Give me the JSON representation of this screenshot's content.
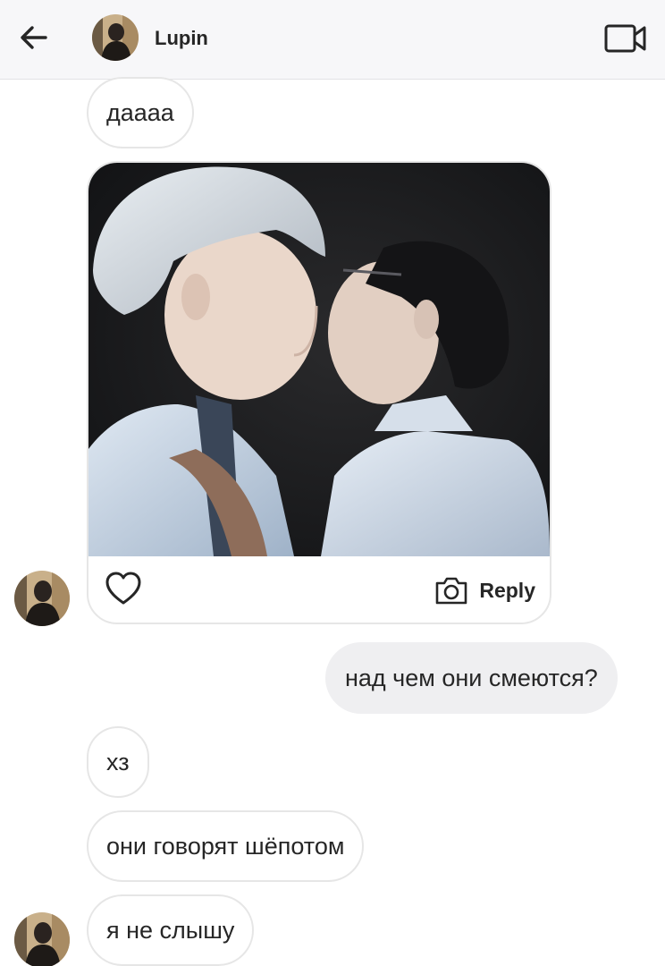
{
  "header": {
    "back_icon": "arrow-left-icon",
    "contact_name": "Lupin",
    "video_icon": "video-call-icon"
  },
  "messages": [
    {
      "direction": "in",
      "text": "даааа"
    },
    {
      "direction": "in",
      "type": "shared-post",
      "reply_label": "Reply",
      "like_icon": "heart-icon",
      "reply_icon": "camera-icon"
    },
    {
      "direction": "out",
      "text": "над чем они смеются?"
    },
    {
      "direction": "in",
      "text": "хз"
    },
    {
      "direction": "in",
      "text": "они говорят шёпотом"
    },
    {
      "direction": "in",
      "text": "я не слышу"
    }
  ],
  "colors": {
    "header_bg": "#f7f7f9",
    "incoming_border": "#e6e6e6",
    "outgoing_bg": "#efeff1",
    "text": "#262626"
  }
}
